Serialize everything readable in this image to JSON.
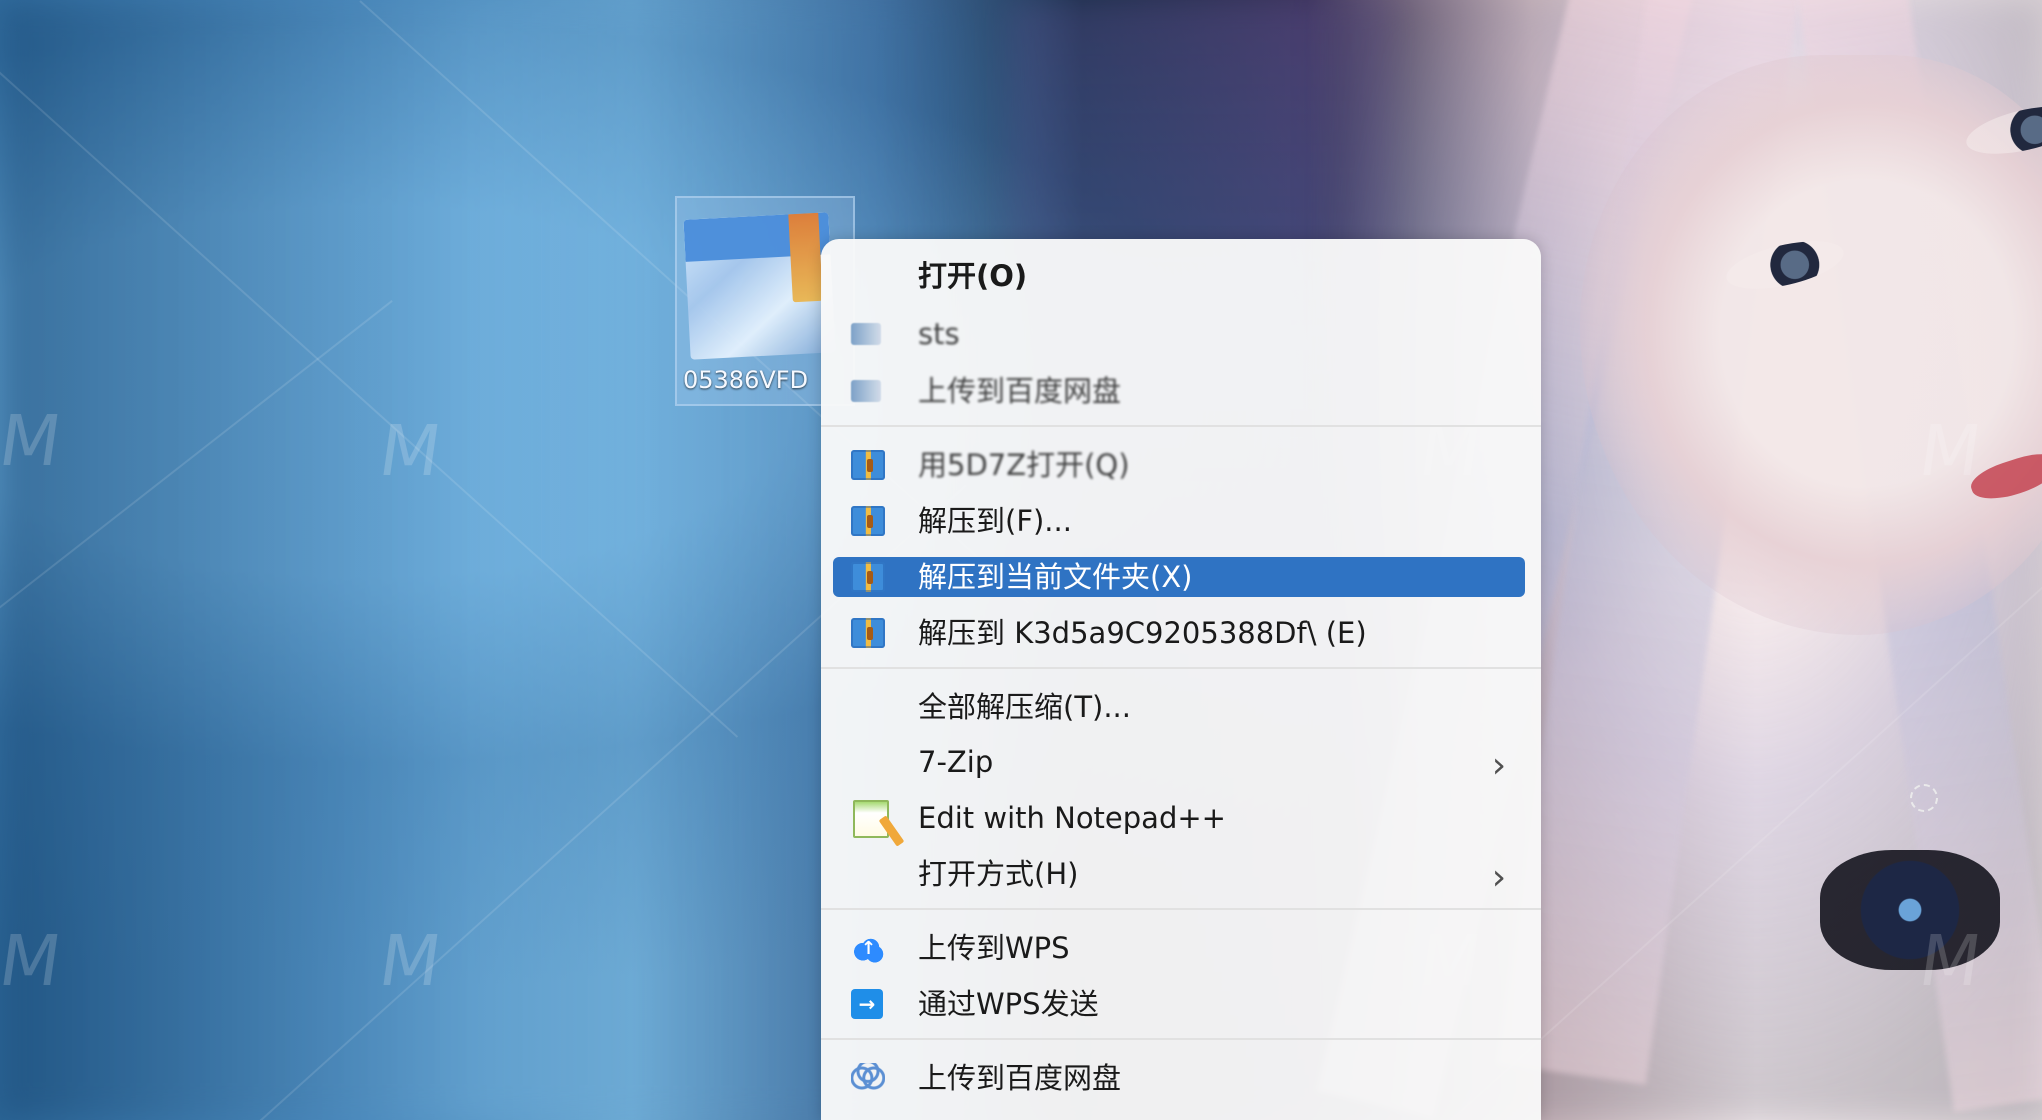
{
  "desktop": {
    "file_label": "05386VFD",
    "watermark_text": "M"
  },
  "context_menu": {
    "items": [
      {
        "label": "打开(O)",
        "icon": "",
        "bold": true
      },
      {
        "label": "sts",
        "icon": "blurred-small-icon",
        "blurred": true
      },
      {
        "label": "上传到百度网盘",
        "icon": "blurred-small-icon",
        "blurred": true
      },
      {
        "label": "用5D7Z打开(Q)",
        "icon": "zip-icon",
        "blurred": true
      },
      {
        "label": "解压到(F)...",
        "icon": "zip-icon"
      },
      {
        "label": "解压到当前文件夹(X)",
        "icon": "zip-icon",
        "highlighted": true
      },
      {
        "label": "解压到 K3d5a9C9205388Df\\ (E)",
        "icon": "zip-icon"
      },
      {
        "label": "全部解压缩(T)...",
        "icon": ""
      },
      {
        "label": "7-Zip",
        "icon": "",
        "submenu": true
      },
      {
        "label": "Edit with Notepad++",
        "icon": "notepad-icon"
      },
      {
        "label": "打开方式(H)",
        "icon": "",
        "submenu": true
      },
      {
        "label": "上传到WPS",
        "icon": "cloud-upload-icon"
      },
      {
        "label": "通过WPS发送",
        "icon": "send-icon"
      },
      {
        "label": "上传到百度网盘",
        "icon": "baidu-cloud-icon"
      }
    ]
  },
  "colors": {
    "menu_background": "#f9f9f9",
    "highlight": "#2f73c3",
    "text": "#1a1a1a"
  }
}
